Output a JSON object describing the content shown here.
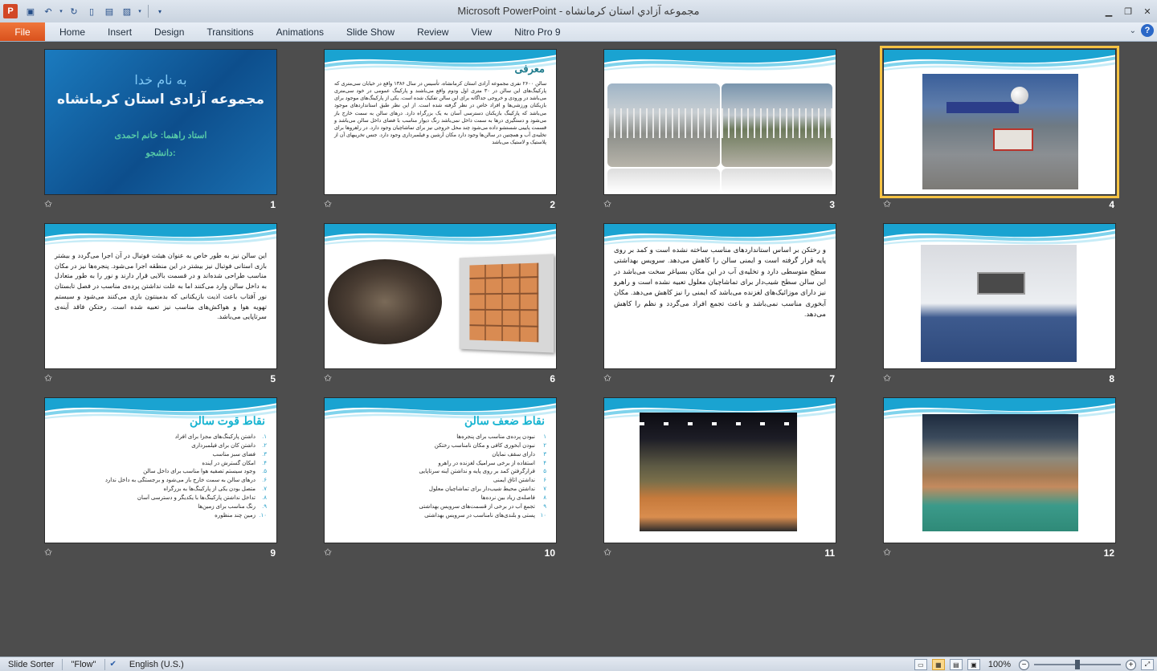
{
  "window": {
    "title": "مجموعه آزادي استان كرمانشاه  -  Microsoft PowerPoint",
    "app_icon": "P"
  },
  "ribbon": {
    "file": "File",
    "tabs": [
      "Home",
      "Insert",
      "Design",
      "Transitions",
      "Animations",
      "Slide Show",
      "Review",
      "View",
      "Nitro Pro 9"
    ]
  },
  "slides": [
    {
      "number": "1",
      "title_line1": "به نام خدا",
      "title_line2": "مجموعه آزادی استان کرمانشاه",
      "line3": "استاد راهنما: خانم احمدی",
      "line4": "دانشجو:"
    },
    {
      "number": "2",
      "title": "معرفی",
      "body": "سالن ۲۶۰۰ نفری مجموعه آزادی استان کرمانشاه، تأسیس در سال ۱۳۸۶ واقع در خیابان سی‌متری که پارکینگ‌های این سالن در ۳۰ متری اول ودوم واقع می‌باشند و پارکینگ عمومی در خود سی‌متری می‌باشد در ورودی و خروجی جداگانه برای این سالن تفکیک شده است. یکی از پارکینگ‌های موجود برای بازیکنان ورزشی‌ها و افراد خاص در نظر گرفته شده است. از این نظر طبق استانداردهای موجود می‌باشد که پارکینگ بازیکنان دسترسی آسان به یک بزرگراه دارد. درهای سالن به سمت خارج باز می‌شود و دستگیری درها به سمت داخل نمی‌باشد رنگ دیوار مناسب با فضای داخل سالن می‌باشد و قسمت پایینی شستشو داده می‌شود چند محل خروجی نیز برای تماشاچیان وجود دارد. در راهروها برای تخلیه‌ی آب و همچنین در سالن‌ها وجود دارد مکان آرشین و فیلمبرداری وجود دارد. جنس تخریبهای آن از پلاستیک و لاستیک می‌باشد"
    },
    {
      "number": "3"
    },
    {
      "number": "4"
    },
    {
      "number": "5",
      "body": "این سالن نیز به طور خاص به عنوان هیئت فوتبال در آن اجرا می‌گردد و بیشتر بازی استانی فوتبال نیز بیشتر در این منطقه اجرا می‌شود. پنجره‌ها نیز در مکان مناسب طراحی شده‌اند و در قسمت بالایی قرار دارند و نور را به طور متعادل به داخل سالن وارد می‌کنند اما به علت نداشتن پرده‌ی مناسب در فصل تابستان نور آفتاب باعث اذیت بازیکنانی که بدمینتون بازی می‌کنند می‌شود و سیستم تهویه هوا و هواکش‌های مناسب نیز تعبیه شده است. رختکن فاقد آینه‌ی سرتاپایی می‌باشد."
    },
    {
      "number": "6"
    },
    {
      "number": "7",
      "body": "و رختکن بر اساس استانداردهای مناسب ساخته نشده است و کمد بر روی پایه قرار گرفته است و ایمنی سالن را کاهش می‌دهد. سرویس بهداشتی سطح متوسطی دارد و تخلیه‌ی آب در این مکان بسیاغر سخت می‌باشد در این سالن سطح شیب‌دار برای تماشاچیان معلول تعبیه نشده است و راهرو نیز دارای موزائیک‌های لغزنده می‌باشد که ایمنی را نیز کاهش می‌دهد. مکان آبخوری مناسب نمی‌باشد و باعث تجمع افراد می‌گردد و نظم را کاهش می‌دهد."
    },
    {
      "number": "8"
    },
    {
      "number": "9",
      "title": "نقاط قوت سالن",
      "items": [
        {
          "n": "۱.",
          "text": "داشتن پارکینگ‌های مجزا برای افراد"
        },
        {
          "n": "۲.",
          "text": "داشتن کان برای فیلمبرداری"
        },
        {
          "n": "۳.",
          "text": "فضای سبز مناسب"
        },
        {
          "n": "۴.",
          "text": "امکان گسترش در آینده"
        },
        {
          "n": "۵.",
          "text": "وجود سیستم تصفیه هوا مناسب برای داخل سالن"
        },
        {
          "n": "۶.",
          "text": "درهای سالن به سمت خارج باز می‌شود و برجستگی به داخل ندارد"
        },
        {
          "n": "۷.",
          "text": "متصل بودن یکی از پارکینگ‌ها به بزرگراه"
        },
        {
          "n": "۸.",
          "text": "تداخل نداشتن پارکینگ‌ها با یکدیگر و دسترسی آسان"
        },
        {
          "n": "۹.",
          "text": "رنگ مناسب برای زمین‌ها"
        },
        {
          "n": "۱۰.",
          "text": "زمین چند منظوره"
        }
      ]
    },
    {
      "number": "10",
      "title": "نقاط ضعف سالن",
      "items": [
        {
          "n": "۱",
          "text": "نبودن پرده‌ی مناسب برای پنجره‌ها"
        },
        {
          "n": "۲",
          "text": "نبودن آبخوری کافی و مکان نامناسب رختکن"
        },
        {
          "n": "۳",
          "text": "دارای سقف نمایان"
        },
        {
          "n": "۴",
          "text": "استفاده از برخی سرامیک لغزنده در راهرو"
        },
        {
          "n": "۵",
          "text": "قرارگرفتن کمد بر روی پایه و نداشتن آینه سرتاپایی"
        },
        {
          "n": "۶",
          "text": "نداشتن اتاق ایمنی"
        },
        {
          "n": "۷",
          "text": "نداشتن محیط شیب‌دار برای تماشاچیان معلول"
        },
        {
          "n": "۸",
          "text": "فاصله‌ی زیاد بین نرده‌ها"
        },
        {
          "n": "۹",
          "text": "تجمع آب در برخی از قسمت‌های سرویس بهداشتی"
        },
        {
          "n": "۱۰",
          "text": "پستی و بلندی‌های نامناسب در سرویس بهداشتی"
        }
      ]
    },
    {
      "number": "11"
    },
    {
      "number": "12"
    }
  ],
  "statusbar": {
    "view": "Slide Sorter",
    "theme": "\"Flow\"",
    "language": "English (U.S.)",
    "zoom": "100%",
    "zoom_level_fraction": 0.5
  },
  "colors": {
    "accent": "#f6c343",
    "file_tab": "#d9511c",
    "title_cyan": "#18b4d1"
  }
}
